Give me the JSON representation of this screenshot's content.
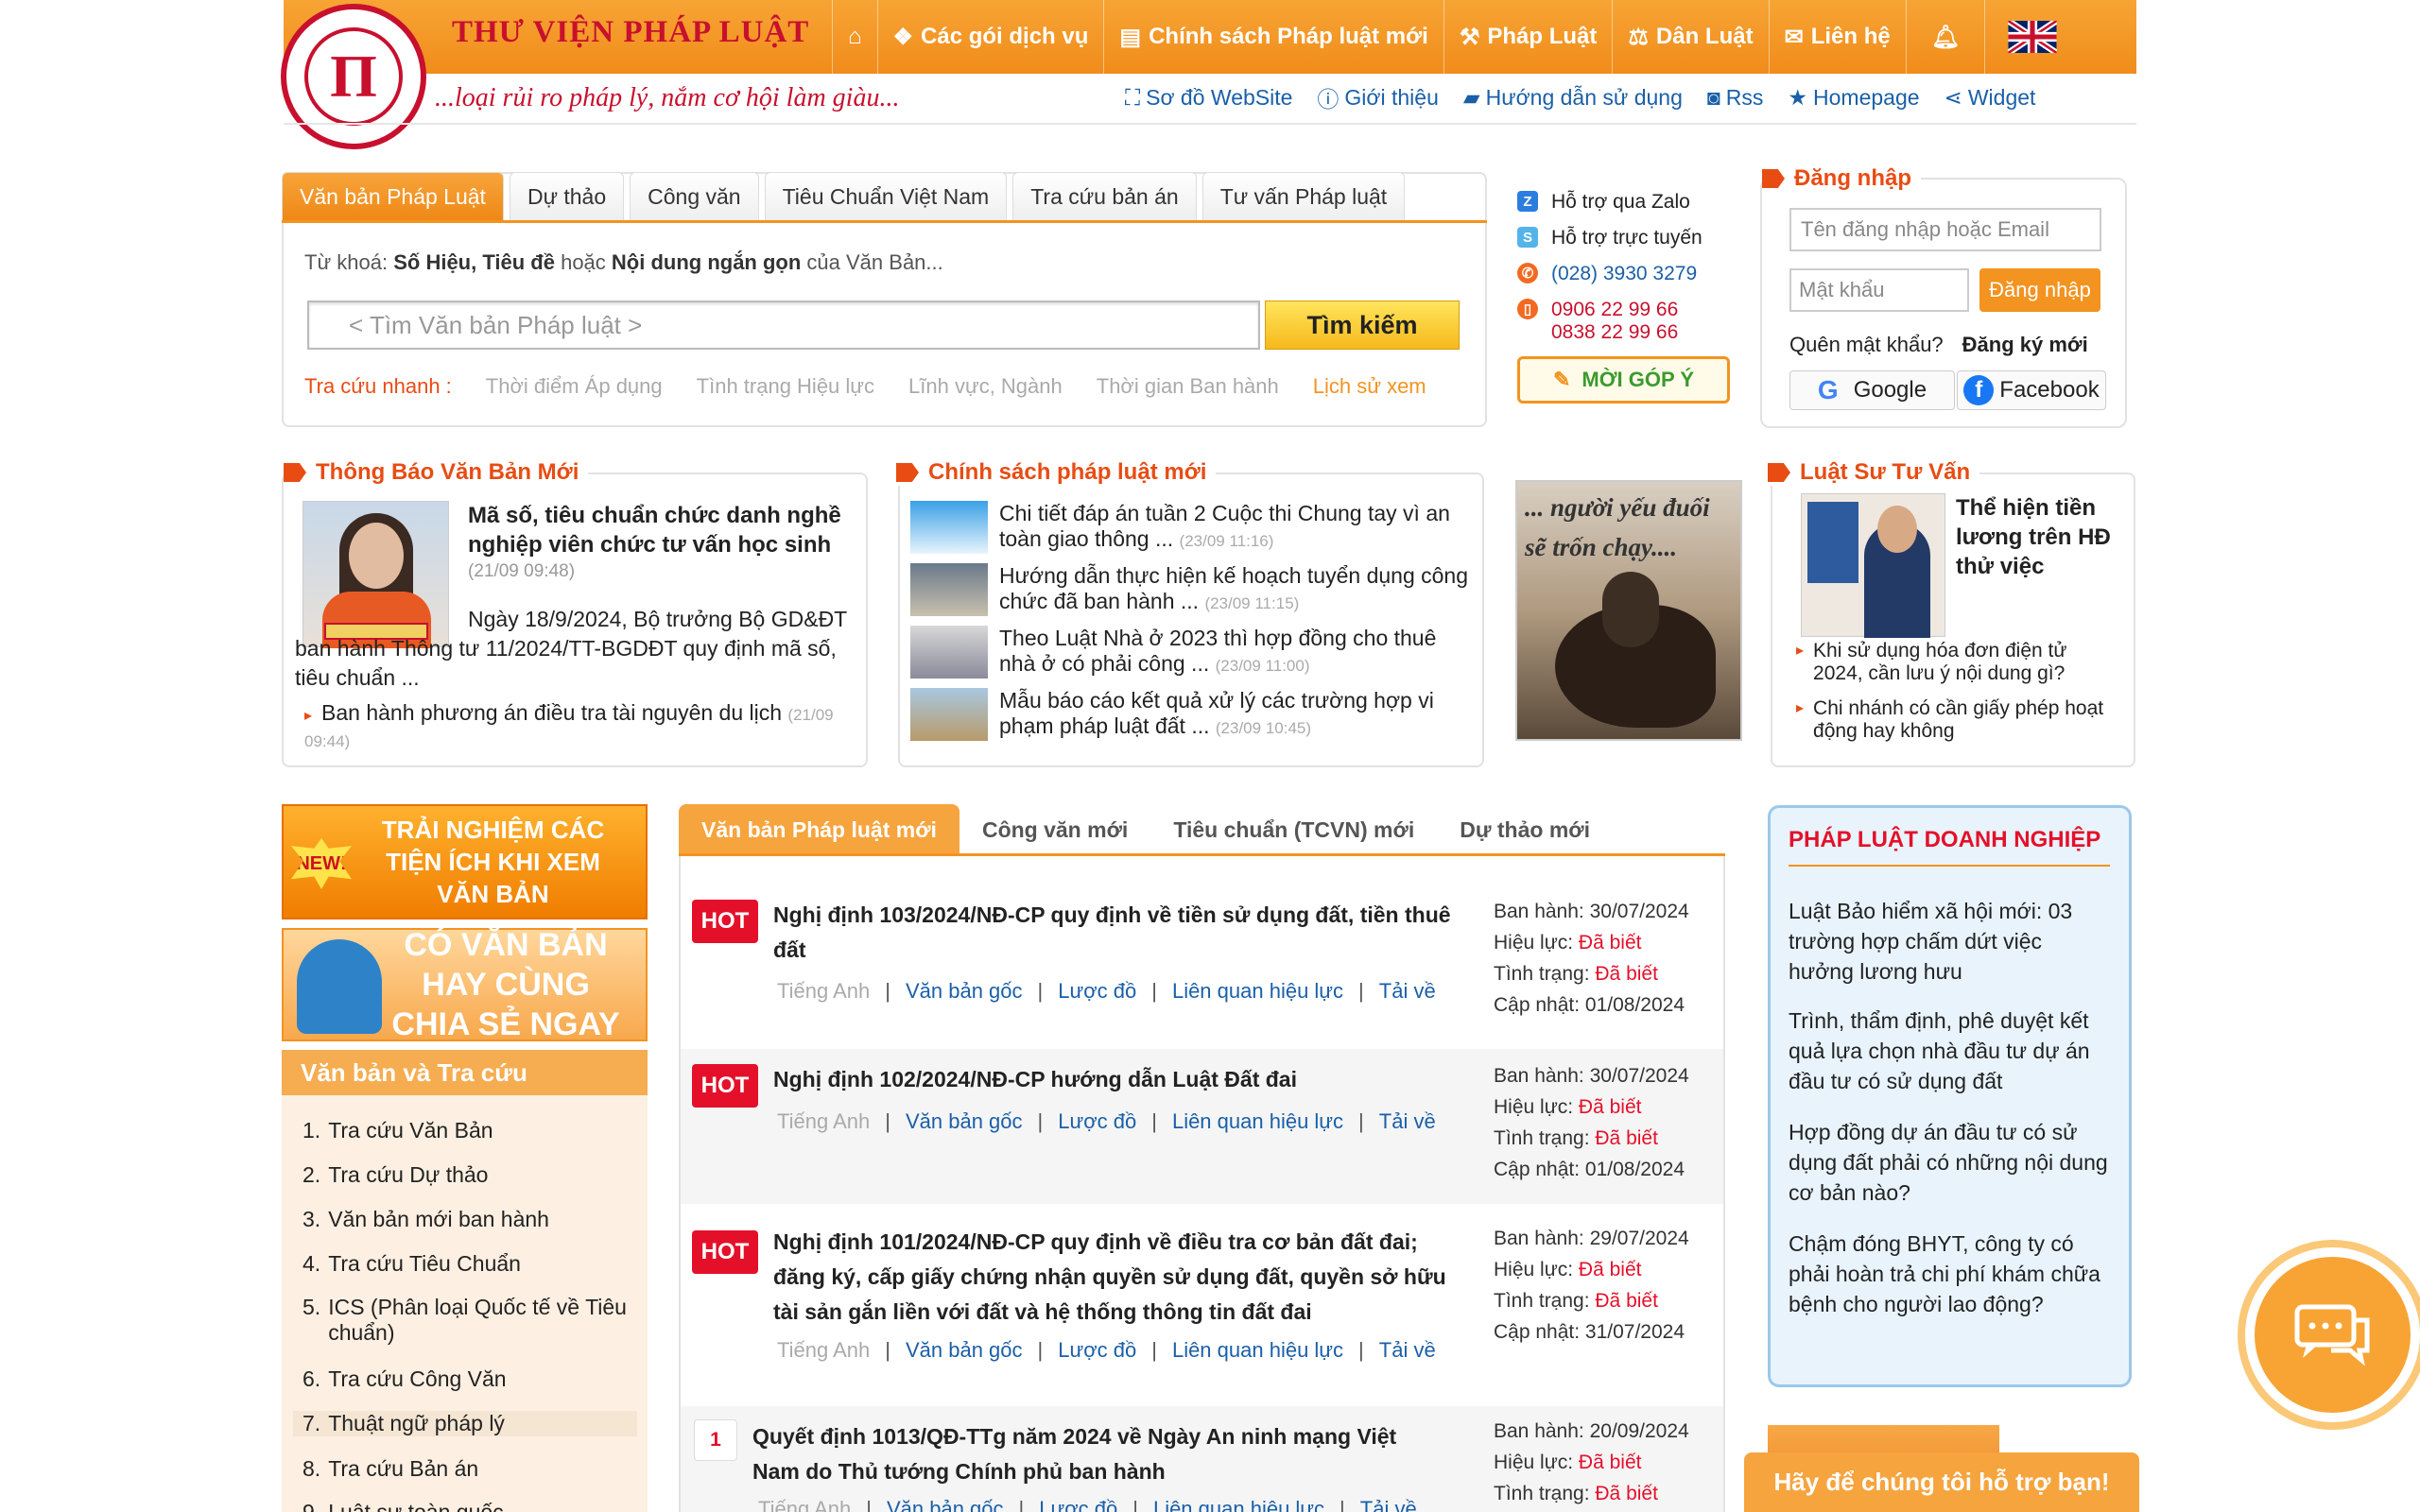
{
  "header": {
    "brand": "THƯ VIỆN PHÁP LUẬT",
    "slogan": "...loại rủi ro pháp lý, nắm cơ hội làm giàu...",
    "nav": [
      {
        "label": "",
        "icon": "home-icon"
      },
      {
        "label": "Các gói dịch vụ",
        "icon": "gift-icon"
      },
      {
        "label": "Chính sách Pháp luật mới",
        "icon": "newspaper-icon"
      },
      {
        "label": "Pháp Luật",
        "icon": "gavel-icon"
      },
      {
        "label": "Dân Luật",
        "icon": "scale-icon"
      },
      {
        "label": "Liên hệ",
        "icon": "mail-icon"
      },
      {
        "label": "",
        "icon": "bell-icon"
      },
      {
        "label": "",
        "icon": "uk-flag-icon"
      }
    ],
    "subnav": [
      {
        "label": "Sơ đồ WebSite",
        "icon": "sitemap-icon"
      },
      {
        "label": "Giới thiệu",
        "icon": "info-icon"
      },
      {
        "label": "Hướng dẫn sử dụng",
        "icon": "book-icon"
      },
      {
        "label": "Rss",
        "icon": "rss-icon"
      },
      {
        "label": "Homepage",
        "icon": "star-icon"
      },
      {
        "label": "Widget",
        "icon": "share-icon"
      }
    ]
  },
  "search": {
    "tabs": [
      "Văn bản Pháp Luật",
      "Dự thảo",
      "Công văn",
      "Tiêu Chuẩn Việt Nam",
      "Tra cứu bản án",
      "Tư vấn Pháp luật"
    ],
    "hint_prefix": "Từ khoá: ",
    "hint_b1": "Số Hiệu, Tiêu đề",
    "hint_mid": " hoặc ",
    "hint_b2": "Nội dung ngắn gọn",
    "hint_suffix": " của Văn Bản...",
    "placeholder": "< Tìm Văn bản Pháp luật >",
    "button": "Tìm kiếm",
    "quick_label": "Tra cứu nhanh :",
    "quick": [
      "Thời điểm Áp dụng",
      "Tình trạng Hiệu lực",
      "Lĩnh vực, Ngành",
      "Thời gian Ban hành"
    ],
    "history": "Lịch sử xem"
  },
  "support": {
    "zalo": "Hỗ trợ qua Zalo",
    "online": "Hỗ trợ trực tuyến",
    "phone": "(028) 3930 3279",
    "mobile1": "0906 22 99 66",
    "mobile2": "0838 22 99 66",
    "feedback": "MỜI GÓP Ý"
  },
  "login": {
    "title": "Đăng nhập",
    "user_placeholder": "Tên đăng nhập hoặc Email",
    "pass_placeholder": "Mật khẩu",
    "button": "Đăng nhập",
    "forgot": "Quên mật khẩu?",
    "register": "Đăng ký mới",
    "google": "Google",
    "facebook": "Facebook"
  },
  "notice": {
    "title": "Thông Báo Văn Bản Mới",
    "headline": "Mã số, tiêu chuẩn chức danh nghề nghiệp viên chức tư vấn học sinh",
    "date": "(21/09 09:48)",
    "summary": "Ngày 18/9/2024, Bộ trưởng Bộ GD&ĐT ban hành Thông tư 11/2024/TT-BGDĐT quy định mã số, tiêu chuẩn ...",
    "more": "Ban hành phương án điều tra tài nguyên du lịch",
    "more_date": "(21/09 09:44)"
  },
  "policy": {
    "title": "Chính sách pháp luật mới",
    "items": [
      {
        "text": "Chi tiết đáp án tuần 2 Cuộc thi Chung tay vì an toàn giao thông ...",
        "time": "(23/09 11:16)"
      },
      {
        "text": "Hướng dẫn thực hiện kế hoạch tuyển dụng công chức đã ban hành ...",
        "time": "(23/09 11:15)"
      },
      {
        "text": "Theo Luật Nhà ở 2023 thì hợp đồng cho thuê nhà ở có phải công ...",
        "time": "(23/09 11:00)"
      },
      {
        "text": "Mẫu báo cáo kết quả xử lý các trường hợp vi phạm pháp luật đất ...",
        "time": "(23/09 10:45)"
      }
    ]
  },
  "art": {
    "line1": "... người yếu đuối",
    "line2": "sẽ trốn chạy...."
  },
  "lawyer": {
    "title": "Luật Sư Tư Vấn",
    "headline": "Thể hiện tiền lương trên HĐ thử việc",
    "items": [
      "Khi sử dụng hóa đơn điện tử 2024, cần lưu ý nội dung gì?",
      "Chi nhánh có cần giấy phép hoạt động hay không"
    ]
  },
  "sidebar": {
    "banner1": "TRẢI NGHIỆM CÁC TIỆN ÍCH KHI XEM VĂN BẢN",
    "banner1_badge": "NEW!",
    "banner2": "CÓ VĂN BẢN HAY CÙNG CHIA SẺ NGAY",
    "menu_title": "Văn bản và Tra cứu",
    "items": [
      "Tra cứu Văn Bản",
      "Tra cứu Dự thảo",
      "Văn bản mới ban hành",
      "Tra cứu Tiêu Chuẩn",
      "ICS (Phân loại Quốc tế về Tiêu chuẩn)",
      "Tra cứu Công Văn",
      "Thuật ngữ pháp lý",
      "Tra cứu Bản án",
      "Luật sư toàn quốc"
    ]
  },
  "docs": {
    "tabs": [
      "Văn bản Pháp luật mới",
      "Công văn mới",
      "Tiêu chuẩn (TCVN) mới",
      "Dự thảo mới"
    ],
    "hot": "HOT",
    "link_labels": [
      "Tiếng Anh",
      "Văn bản gốc",
      "Lược đồ",
      "Liên quan hiệu lực",
      "Tải về"
    ],
    "meta_labels": {
      "issued": "Ban hành: ",
      "effect": "Hiệu lực: ",
      "status": "Tình trạng: ",
      "updated": "Cập nhật: "
    },
    "items": [
      {
        "title": "Nghị định 103/2024/NĐ-CP quy định về tiền sử dụng đất, tiền thuê đất",
        "issued": "30/07/2024",
        "effect": "Đã biết",
        "status": "Đã biết",
        "updated": "01/08/2024"
      },
      {
        "title": "Nghị định 102/2024/NĐ-CP hướng dẫn Luật Đất đai",
        "issued": "30/07/2024",
        "effect": "Đã biết",
        "status": "Đã biết",
        "updated": "01/08/2024"
      },
      {
        "title": "Nghị định 101/2024/NĐ-CP quy định về điều tra cơ bản đất đai; đăng ký, cấp giấy chứng nhận quyền sử dụng đất, quyền sở hữu tài sản gắn liền với đất và hệ thống thông tin đất đai",
        "issued": "29/07/2024",
        "effect": "Đã biết",
        "status": "Đã biết",
        "updated": "31/07/2024"
      },
      {
        "num": "1",
        "title": "Quyết định 1013/QĐ-TTg năm 2024 về Ngày An ninh mạng Việt Nam do Thủ tướng Chính phủ ban hành",
        "issued": "20/09/2024",
        "effect": "Đã biết",
        "status": "Đã biết"
      }
    ]
  },
  "business": {
    "title": "PHÁP LUẬT DOANH NGHIỆP",
    "items": [
      "Luật Bảo hiểm xã hội mới: 03 trường hợp chấm dứt việc hưởng lương hưu",
      "Trình, thẩm định, phê duyệt kết quả lựa chọn nhà đầu tư dự án đầu tư có sử dụng đất",
      "Hợp đồng dự án đầu tư có sử dụng đất phải có những nội dung cơ bản nào?",
      "Chậm đóng BHYT, công ty có phải hoàn trả chi phí khám chữa bệnh cho người lao động?"
    ]
  },
  "chat": {
    "bar": "Hãy để chúng tôi hỗ trợ bạn!"
  },
  "colors": {
    "accent": "#f39320",
    "brand_red": "#c8102e",
    "link": "#1a5fa8",
    "hot": "#e4102a"
  }
}
